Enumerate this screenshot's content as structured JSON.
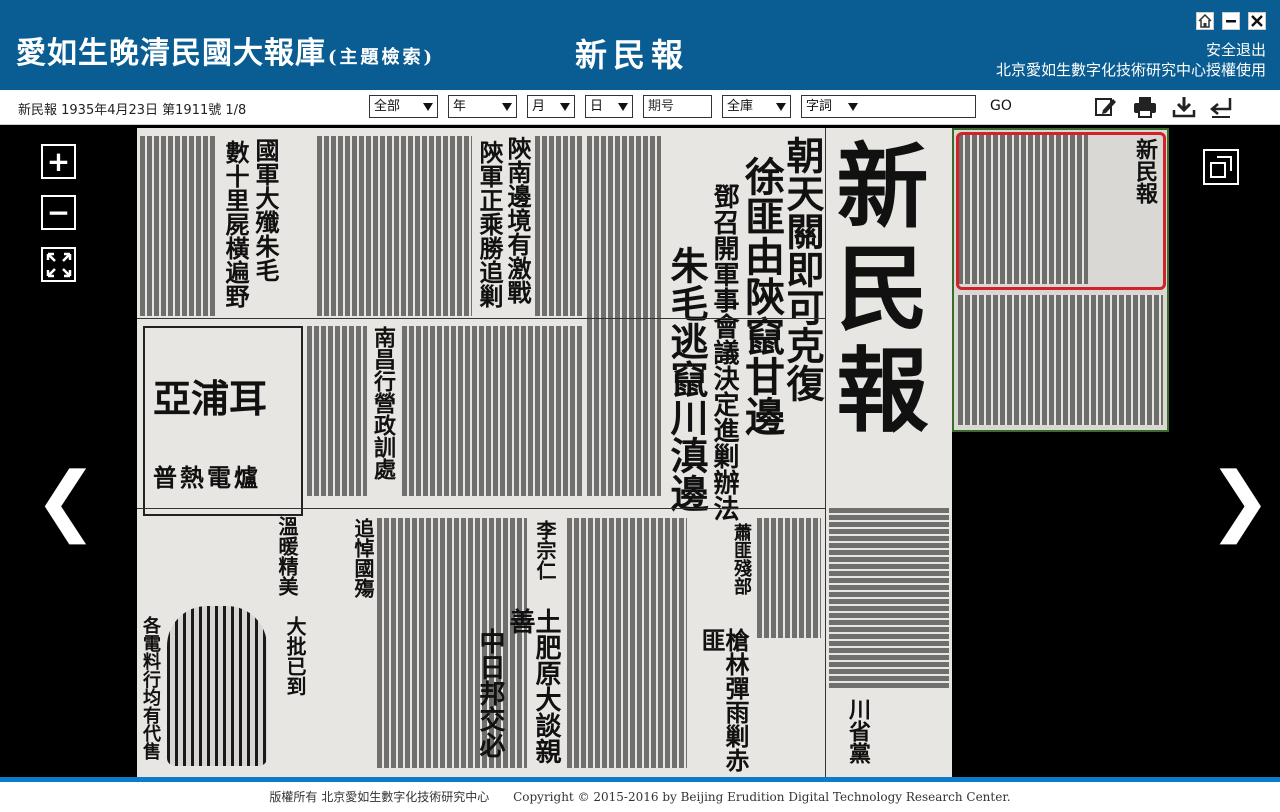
{
  "header": {
    "brand": "愛如生晚清民國大報庫",
    "brand_sub": "(主題檢索)",
    "paper_name": "新民報",
    "logout": "安全退出",
    "license": "北京愛如生數字化技術研究中心授權使用",
    "window_icons": [
      "home-icon",
      "minimize-icon",
      "close-icon"
    ]
  },
  "toolbar": {
    "issue_info": "新民報 1935年4月23日 第1911號 1/8",
    "filters": {
      "scope": "全部",
      "year": "年",
      "month": "月",
      "day": "日",
      "issue_placeholder": "期号",
      "library": "全庫",
      "word": "字詞"
    },
    "go": "GO",
    "icons": [
      "edit-icon",
      "print-icon",
      "download-icon",
      "return-icon"
    ]
  },
  "viewer": {
    "zoom_in": "+",
    "zoom_out": "−",
    "prev": "❮",
    "next": "❯"
  },
  "newspaper": {
    "masthead": "新民報",
    "headline_1": "朝天關即可克復",
    "headline_2": "徐匪由陝竄甘邊",
    "headline_3": "鄧召開軍事會議決定進剿辦法",
    "headline_4": "朱毛逃竄川滇邊",
    "headline_5": "陝南邊境有激戰",
    "headline_6": "陝軍正乘勝追剿",
    "headline_7": "國軍大殲朱毛",
    "headline_8": "數十里屍橫遍野",
    "headline_9": "南昌行營政訓處",
    "ad_1": "亞浦耳",
    "ad_2": "普熱電爐",
    "ad_3": "溫暖精美",
    "ad_4": "大批已到",
    "ad_5": "各電料行均有代售",
    "headline_10": "李宗仁",
    "headline_11": "追悼國殤",
    "headline_12": "土肥原大談親善",
    "headline_13": "中日邦交必",
    "headline_14": "槍林彈雨剿赤匪",
    "headline_15": "川省黨",
    "headline_16": "蕭匪殘部"
  },
  "footer": {
    "rights": "版權所有  北京愛如生數字化技術研究中心",
    "copyright": "Copyright © 2015-2016 by Beijing Erudition Digital Technology Research Center."
  },
  "colors": {
    "header_bg": "#0a5d92",
    "footer_accent": "#0a7cc9",
    "thumb_frame": "#d2232a"
  }
}
